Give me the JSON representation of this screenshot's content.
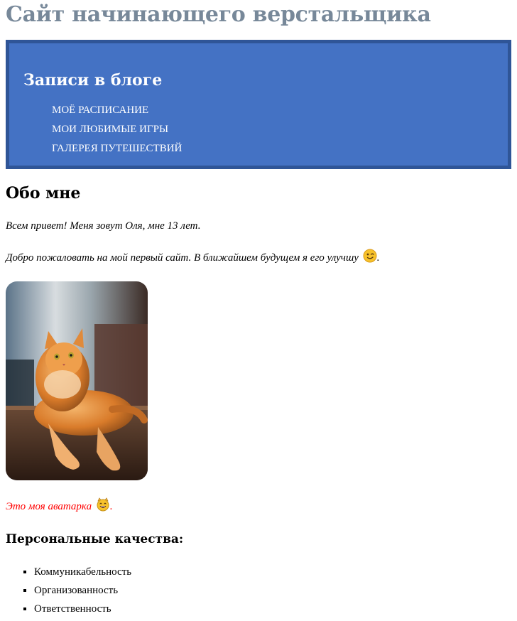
{
  "site": {
    "title": "Сайт начинающего верстальщика"
  },
  "blog": {
    "title": "Записи в блоге",
    "links": [
      {
        "label": "МОЁ РАСПИСАНИЕ"
      },
      {
        "label": "МОИ ЛЮБИМЫЕ ИГРЫ"
      },
      {
        "label": "ГАЛЕРЕЯ ПУТЕШЕСТВИЙ"
      }
    ]
  },
  "about": {
    "title": "Обо мне",
    "intro": "Всем привет! Меня зовут Оля, мне 13 лет.",
    "welcome": "Добро пожаловать на мой первый сайт. В ближайшем будущем я его улучшу",
    "welcome_end": ".",
    "caption": "Это моя аватарка",
    "caption_end": "."
  },
  "qualities": {
    "title": "Персональные качества:",
    "items": [
      "Коммуникабельность",
      "Организованность",
      "Ответственность"
    ]
  },
  "colors": {
    "title": "#778899",
    "blog_bg": "#4472c4",
    "blog_border": "#2f5597",
    "caption": "#ff0000"
  },
  "icons": {
    "wink": "winking-face-icon",
    "cat": "smiling-cat-icon",
    "avatar": "orange-cat-photo"
  }
}
